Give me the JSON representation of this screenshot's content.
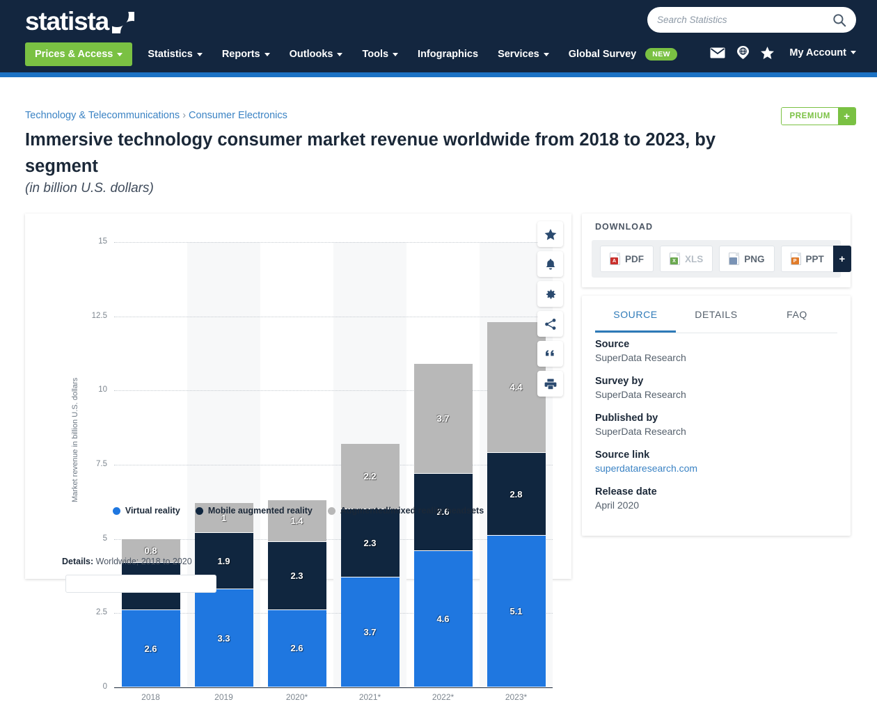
{
  "header": {
    "brand": "statista",
    "nav": [
      {
        "label": "Prices & Access",
        "caret": true,
        "primary": true
      },
      {
        "label": "Statistics",
        "caret": true
      },
      {
        "label": "Reports",
        "caret": true
      },
      {
        "label": "Outlooks",
        "caret": true
      },
      {
        "label": "Tools",
        "caret": true
      },
      {
        "label": "Infographics",
        "caret": false
      },
      {
        "label": "Services",
        "caret": true
      },
      {
        "label": "Global Survey",
        "caret": false,
        "badge": "NEW"
      }
    ],
    "search": {
      "placeholder": "Search Statistics",
      "value": "",
      "icon": "search-icon"
    },
    "utility_icons": [
      "envelope-icon",
      "globe-icon",
      "star-icon"
    ],
    "account_label": "My Account"
  },
  "breadcrumb": {
    "items": [
      "Technology & Telecommunications",
      "Consumer Electronics"
    ],
    "separator": "›"
  },
  "premium": {
    "label": "PREMIUM",
    "plus": "+"
  },
  "page": {
    "title": "Immersive technology consumer market revenue worldwide from 2018 to 2023, by segment",
    "subtitle": "(in billion U.S. dollars)"
  },
  "chart_actions": [
    {
      "name": "star-icon",
      "title": "Favorite"
    },
    {
      "name": "bell-icon",
      "title": "Notify"
    },
    {
      "name": "gear-icon",
      "title": "Settings"
    },
    {
      "name": "share-icon",
      "title": "Share"
    },
    {
      "name": "quote-icon",
      "title": "Cite"
    },
    {
      "name": "print-icon",
      "title": "Print"
    }
  ],
  "chart_data": {
    "type": "bar",
    "subtype": "stacked-column",
    "title": "Immersive technology consumer market revenue worldwide from 2018 to 2023, by segment",
    "subtitle": "(in billion U.S. dollars)",
    "xlabel": "",
    "ylabel": "Market revenue in billion U.S. dollars",
    "categories": [
      "2018",
      "2019",
      "2020*",
      "2021*",
      "2022*",
      "2023*"
    ],
    "ylim": [
      0,
      15
    ],
    "yticks": [
      "0",
      "2.5",
      "5",
      "7.5",
      "10",
      "12.5",
      "15"
    ],
    "ytick_values": [
      0,
      2.5,
      5,
      7.5,
      10,
      12.5,
      15
    ],
    "grid": true,
    "legend_position": "bottom",
    "series": [
      {
        "name": "Virtual reality",
        "color": "#1f77e0",
        "values": [
          2.6,
          3.3,
          2.6,
          3.7,
          4.6,
          5.1
        ],
        "labels": [
          "2.6",
          "3.3",
          "2.6",
          "3.7",
          "4.6",
          "5.1"
        ]
      },
      {
        "name": "Mobile augmented reality",
        "color": "#10263f",
        "values": [
          1.6,
          1.9,
          2.3,
          2.3,
          2.6,
          2.8
        ],
        "labels": [
          "1.6",
          "1.9",
          "2.3",
          "2.3",
          "2.6",
          "2.8"
        ]
      },
      {
        "name": "Augmented/mixed reality headsets",
        "color": "#b8b8b8",
        "values": [
          0.8,
          1.0,
          1.4,
          2.2,
          3.7,
          4.4
        ],
        "labels": [
          "0.8",
          "1",
          "1.4",
          "2.2",
          "3.7",
          "4.4"
        ]
      }
    ],
    "totals": [
      5.0,
      6.2,
      6.3,
      8.2,
      10.9,
      12.3
    ]
  },
  "details": {
    "label": "Details:",
    "value": "Worldwide; 2018 to 2020"
  },
  "download": {
    "title": "DOWNLOAD",
    "buttons": [
      {
        "label": "PDF",
        "icon": "pdf-file-icon",
        "color": "#c9302c",
        "tag": "A",
        "muted": false
      },
      {
        "label": "XLS",
        "icon": "xls-file-icon",
        "color": "#6aa84f",
        "tag": "X",
        "muted": true
      },
      {
        "label": "PNG",
        "icon": "png-file-icon",
        "color": "#7a93b5",
        "tag": "",
        "muted": false
      },
      {
        "label": "PPT",
        "icon": "ppt-file-icon",
        "color": "#e07b2a",
        "tag": "P",
        "muted": false
      }
    ],
    "more": "+"
  },
  "source_panel": {
    "tabs": [
      {
        "label": "SOURCE",
        "active": true
      },
      {
        "label": "DETAILS",
        "active": false
      },
      {
        "label": "FAQ",
        "active": false
      }
    ],
    "fields": [
      {
        "label": "Source",
        "value": "SuperData Research",
        "link": false
      },
      {
        "label": "Survey by",
        "value": "SuperData Research",
        "link": false
      },
      {
        "label": "Published by",
        "value": "SuperData Research",
        "link": false
      },
      {
        "label": "Source link",
        "value": "superdataresearch.com",
        "link": true
      },
      {
        "label": "Release date",
        "value": "April 2020",
        "link": false
      }
    ]
  },
  "colors": {
    "header_bg": "#13263f",
    "header_accent": "#1c72c4",
    "brand_green": "#7ac143",
    "link_blue": "#3b83c4",
    "vr_blue": "#1f77e0",
    "mar_navy": "#10263f",
    "headset_gray": "#b8b8b8"
  }
}
